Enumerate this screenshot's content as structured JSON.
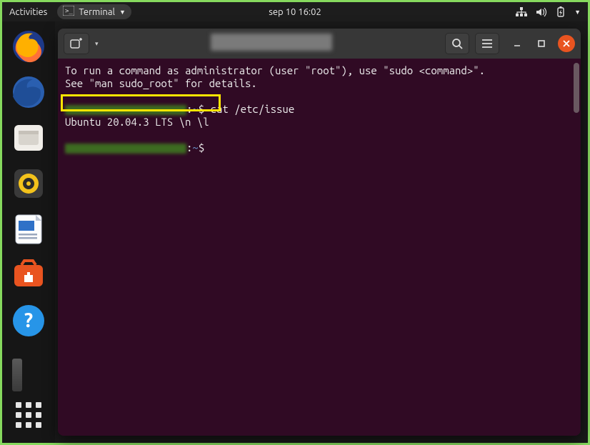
{
  "topbar": {
    "activities": "Activities",
    "app_name": "Terminal",
    "clock": "sep 10  16:02"
  },
  "terminal": {
    "line1": "To run a command as administrator (user \"root\"), use \"sudo <command>\".",
    "line2": "See \"man sudo_root\" for details.",
    "prompt_suffix": ":~$",
    "cmd1": " cat /etc/issue",
    "output1": "Ubuntu 20.04.3 LTS \\n \\l",
    "path": "~",
    "dollar": "$"
  }
}
